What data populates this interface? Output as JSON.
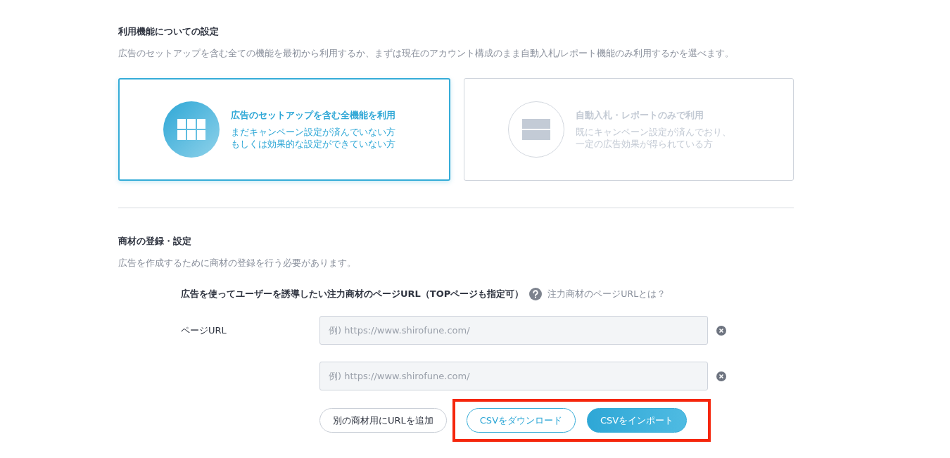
{
  "feature_section": {
    "title": "利用機能についての設定",
    "description": "広告のセットアップを含む全ての機能を最初から利用するか、まずは現在のアカウント構成のまま自動入札/レポート機能のみ利用するかを選べます。",
    "options": [
      {
        "kind": "grid",
        "selected": true,
        "title": "広告のセットアップを含む全機能を利用",
        "lines": [
          "まだキャンペーン設定が済んでいない方",
          "もしくは効果的な設定ができていない方"
        ]
      },
      {
        "kind": "rows",
        "selected": false,
        "title": "自動入札・レポートのみで利用",
        "lines": [
          "既にキャンペーン設定が済んでおり、",
          "一定の広告効果が得られている方"
        ]
      }
    ]
  },
  "product_section": {
    "title": "商材の登録・設定",
    "description": "広告を作成するために商材の登録を行う必要があります。",
    "url_heading": "広告を使ってユーザーを誘導したい注力商材のページURL（TOPページも指定可）",
    "help_link": "注力商材のページURLとは？",
    "field_label": "ページURL",
    "url_fields": [
      {
        "placeholder": "例) https://www.shirofune.com/"
      },
      {
        "placeholder": "例) https://www.shirofune.com/"
      }
    ],
    "add_button": "別の商材用にURLを追加",
    "download_button": "CSVをダウンロード",
    "import_button": "CSVをインポート"
  }
}
